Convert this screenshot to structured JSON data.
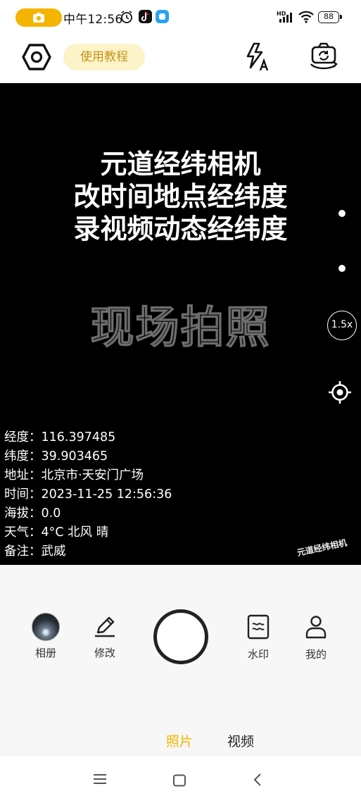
{
  "status_bar": {
    "time": "中午12:56",
    "network": "HD",
    "battery": "88",
    "icons": [
      "camera-icon",
      "alarm-icon",
      "tiktok-icon",
      "app-icon",
      "signal-icon",
      "wifi-icon",
      "battery-icon"
    ]
  },
  "toolbar": {
    "tutorial_label": "使用教程",
    "icons": [
      "settings-icon",
      "flash-auto-icon",
      "switch-camera-icon"
    ]
  },
  "viewfinder": {
    "promo_lines": [
      "元道经纬相机",
      "改时间地点经纬度",
      "录视频动态经纬度"
    ],
    "scene_label": "现场拍照",
    "zoom": "1.5x",
    "watermark": {
      "longitude": "经度：116.397485",
      "latitude": "纬度：39.903465",
      "address": "地址：北京市·天安门广场",
      "time": "时间：2023-11-25 12:56:36",
      "altitude": "海拔：0.0",
      "weather": "天气：4°C 北风 晴",
      "note": "备注：武威"
    },
    "brand": "元道经纬相机"
  },
  "controls": {
    "album": "相册",
    "edit": "修改",
    "watermark": "水印",
    "mine": "我的"
  },
  "modes": {
    "photo": "照片",
    "video": "视频",
    "active": "照片"
  },
  "colors": {
    "accent": "#f5b400",
    "tutorial_bg": "#fdf3c8",
    "tutorial_text": "#c4961a",
    "viewfinder_bg": "#000000"
  }
}
